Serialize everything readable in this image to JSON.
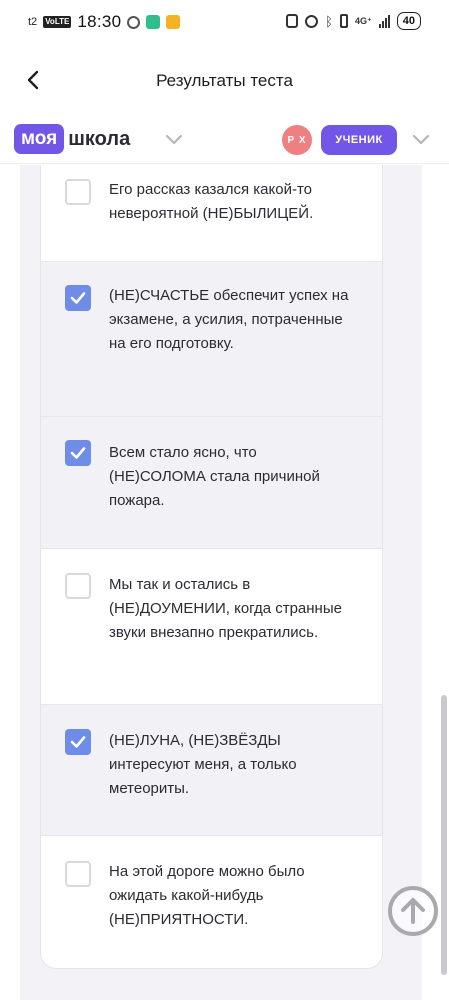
{
  "status_bar": {
    "carrier": "t2",
    "volte": "VoLTE",
    "time": "18:30",
    "network": "4G⁺",
    "battery": "40"
  },
  "header": {
    "title": "Результаты теста",
    "back_icon": "chevron-left-icon"
  },
  "brand": {
    "logo_part1": "моя",
    "logo_part2": "школа",
    "avatar_initials": "Р Х",
    "role": "УЧЕНИК",
    "accent_color": "#7256e8"
  },
  "options": [
    {
      "checked": false,
      "text": "Его рассказ казался какой-то невероятной (НЕ)БЫЛИЦЕЙ."
    },
    {
      "checked": true,
      "text": "(НЕ)СЧАСТЬЕ обеспечит успех на экзамене, а усилия, потраченные на его подготовку."
    },
    {
      "checked": true,
      "text": "Всем стало ясно, что (НЕ)СОЛОМА стала  причиной пожара."
    },
    {
      "checked": false,
      "text": "Мы так и остались в (НЕ)ДОУМЕНИИ, когда странные звуки внезапно прекратились."
    },
    {
      "checked": true,
      "text": "(НЕ)ЛУНА, (НЕ)ЗВЁЗДЫ интересуют меня, а только метеориты."
    },
    {
      "checked": false,
      "text": "На этой дороге можно было ожидать какой-нибудь (НЕ)ПРИЯТНОСТИ."
    }
  ],
  "colors": {
    "checkbox_checked": "#6f8ce9",
    "checked_row_bg": "#f1f1f6"
  }
}
